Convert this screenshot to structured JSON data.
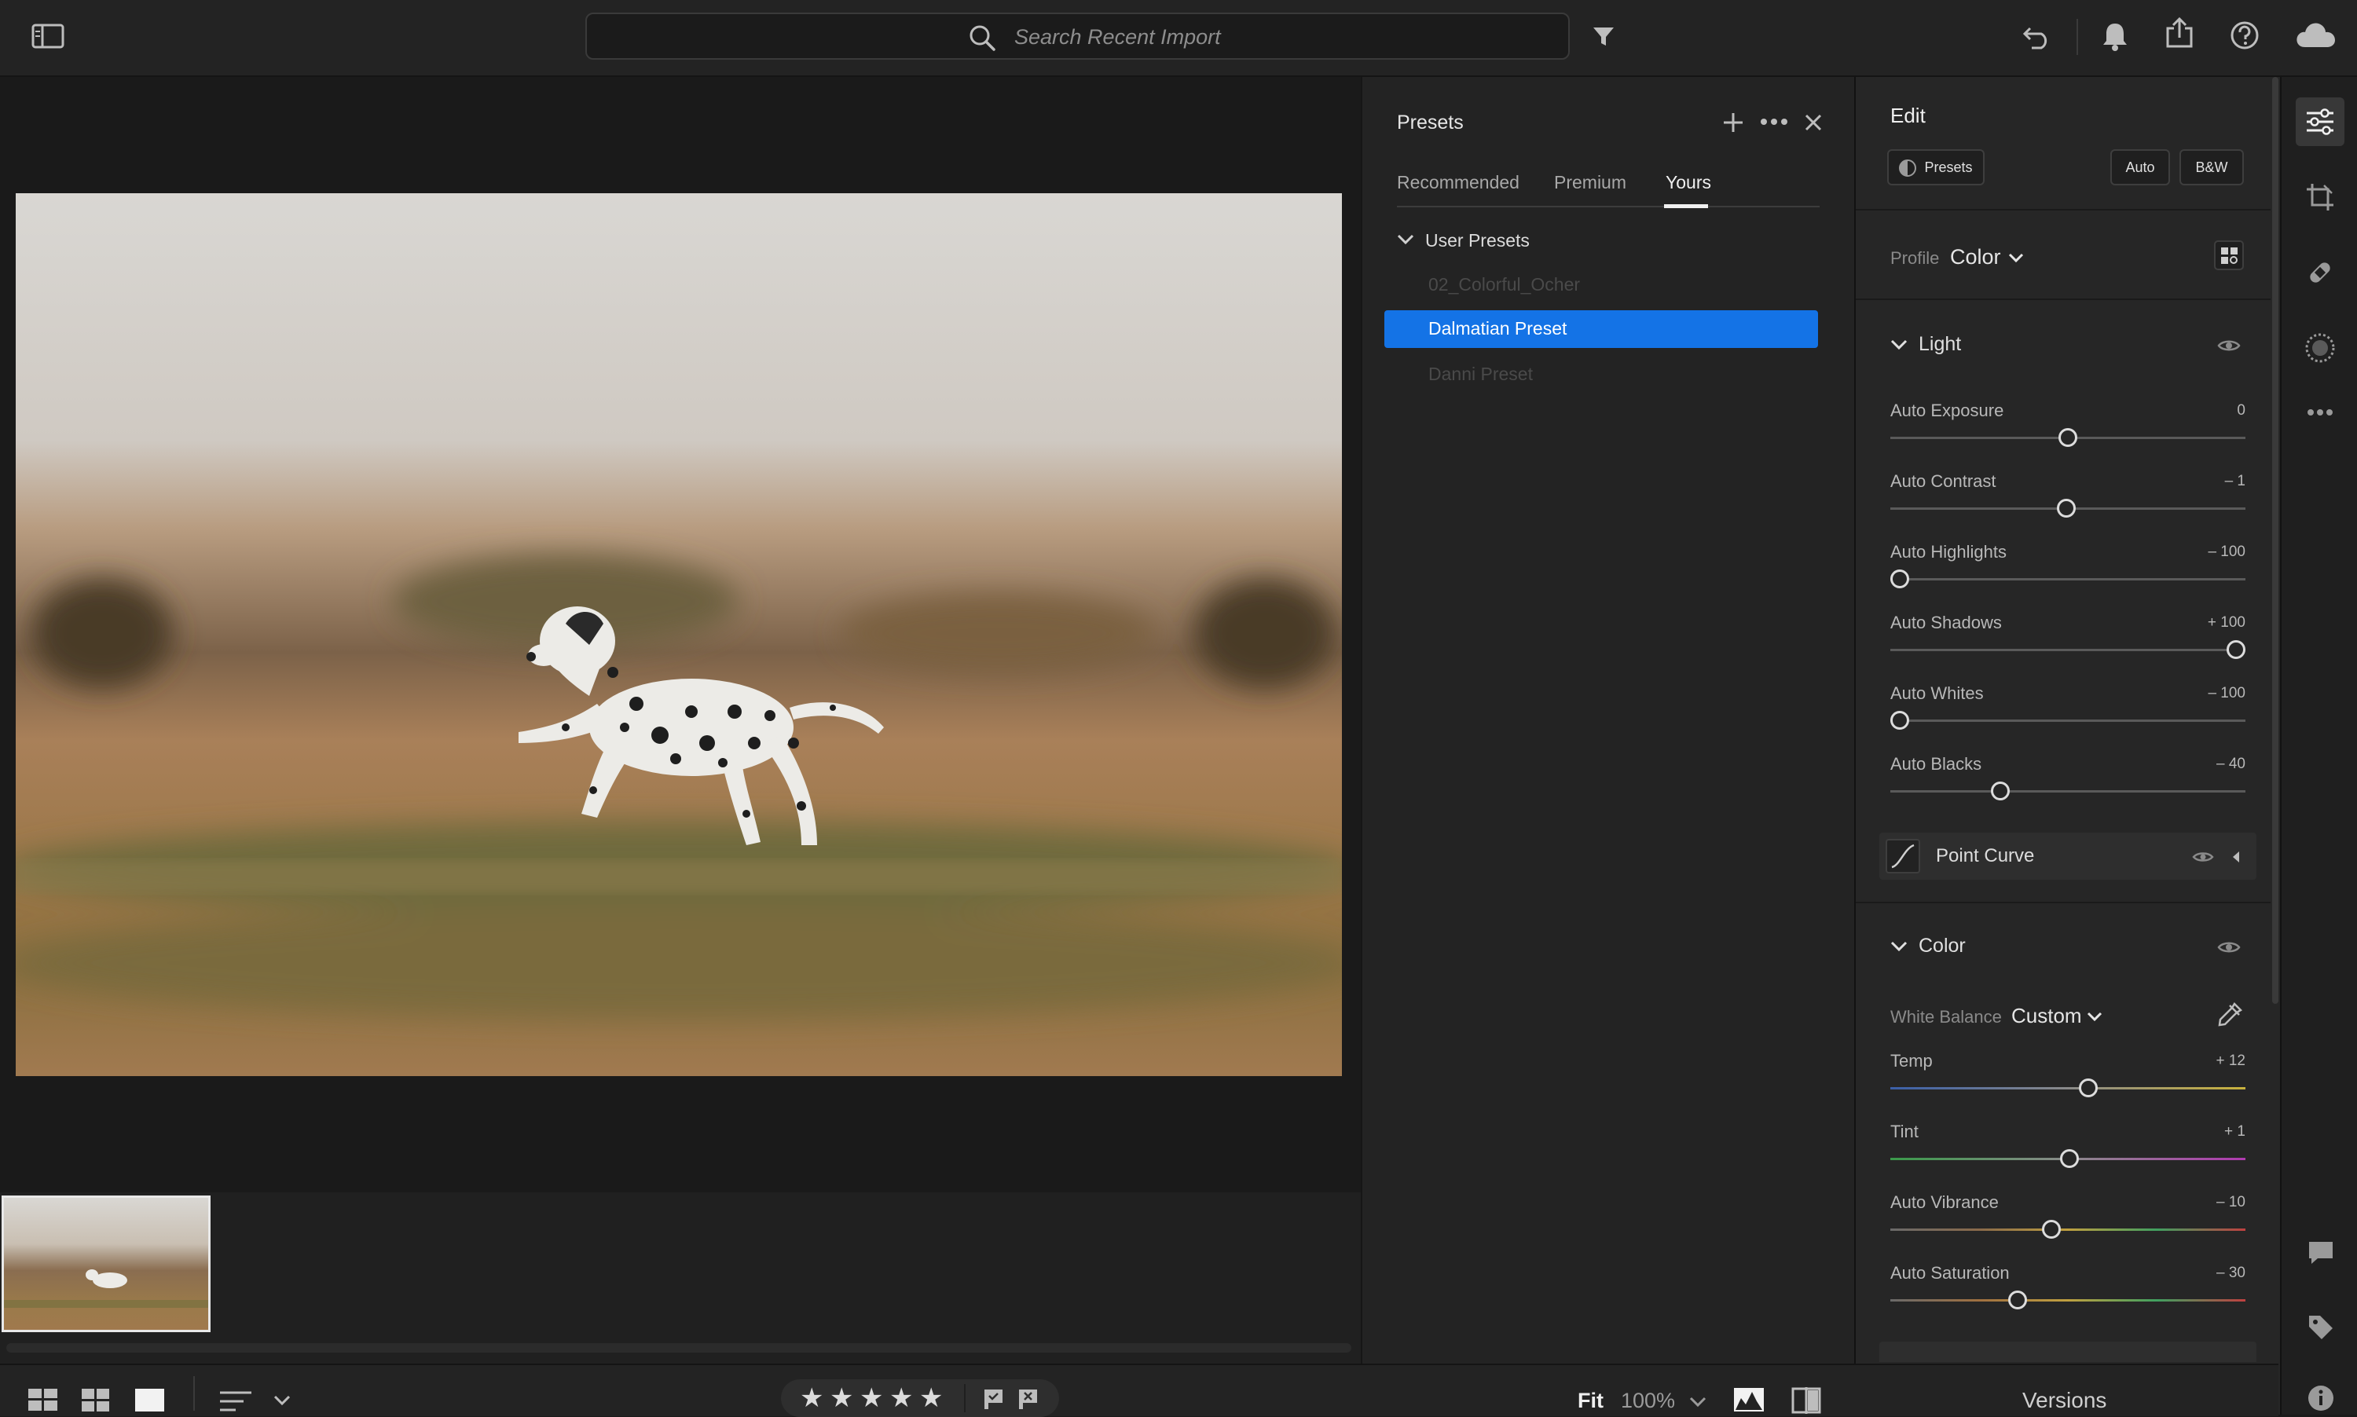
{
  "search": {
    "placeholder": "Search Recent Import"
  },
  "presets_panel": {
    "title": "Presets",
    "tabs": [
      {
        "label": "Recommended"
      },
      {
        "label": "Premium"
      },
      {
        "label": "Yours",
        "active": true
      }
    ],
    "group": {
      "label": "User Presets"
    },
    "items": [
      {
        "label": "02_Colorful_Ocher",
        "state": "faded"
      },
      {
        "label": "Dalmatian Preset",
        "state": "selected"
      },
      {
        "label": "Danni Preset",
        "state": "faded"
      }
    ]
  },
  "edit_panel": {
    "title": "Edit",
    "presets_button": "Presets",
    "auto_button": "Auto",
    "bw_button": "B&W",
    "profile": {
      "label": "Profile",
      "value": "Color"
    },
    "light": {
      "title": "Light",
      "sliders": [
        {
          "label": "Auto Exposure",
          "value": "0",
          "fraction": 0.5
        },
        {
          "label": "Auto Contrast",
          "value": "– 1",
          "fraction": 0.495
        },
        {
          "label": "Auto Highlights",
          "value": "– 100",
          "fraction": 0.0
        },
        {
          "label": "Auto Shadows",
          "value": "+ 100",
          "fraction": 1.0
        },
        {
          "label": "Auto Whites",
          "value": "– 100",
          "fraction": 0.0
        },
        {
          "label": "Auto Blacks",
          "value": "– 40",
          "fraction": 0.3
        }
      ]
    },
    "point_curve": {
      "title": "Point Curve"
    },
    "color": {
      "title": "Color",
      "white_balance": {
        "label": "White Balance",
        "value": "Custom"
      },
      "sliders": [
        {
          "label": "Temp",
          "value": "+ 12",
          "fraction": 0.56
        },
        {
          "label": "Tint",
          "value": "+ 1",
          "fraction": 0.505
        },
        {
          "label": "Auto Vibrance",
          "value": "– 10",
          "fraction": 0.45
        },
        {
          "label": "Auto Saturation",
          "value": "– 30",
          "fraction": 0.35
        }
      ]
    }
  },
  "bottom_bar": {
    "stars": [
      "★",
      "★",
      "★",
      "★",
      "★"
    ],
    "zoom_fit": "Fit",
    "zoom_level": "100%",
    "versions": "Versions"
  },
  "colors": {
    "selected": "#1473e6",
    "panel": "#232323",
    "edit_panel": "#262626"
  }
}
